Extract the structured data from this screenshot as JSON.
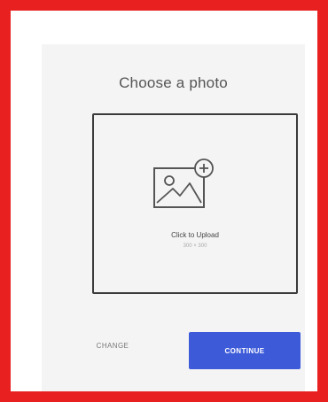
{
  "dialog": {
    "title": "Choose a photo"
  },
  "upload": {
    "label": "Click to Upload",
    "size_hint": "300 × 300",
    "icon": "image-add-icon"
  },
  "actions": {
    "change_label": "CHANGE",
    "continue_label": "CONTINUE"
  },
  "colors": {
    "frame_border": "#e8201f",
    "card_background": "#f4f4f4",
    "primary_button": "#3d5bd9"
  }
}
